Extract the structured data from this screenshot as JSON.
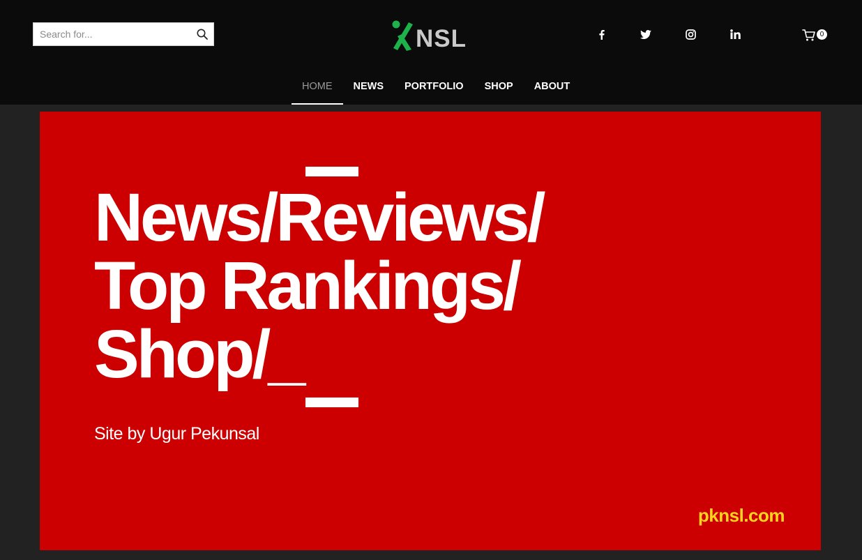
{
  "header": {
    "search": {
      "placeholder": "Search for...",
      "value": "",
      "icon": "search-icon"
    },
    "logo": {
      "text": "NSL",
      "mark_icon": "percent-logo-mark",
      "mark_color": "#1db34a",
      "text_color": "#c9c9c9"
    },
    "social": [
      {
        "name": "facebook",
        "glyph": "f"
      },
      {
        "name": "twitter",
        "glyph": "twitter-bird"
      },
      {
        "name": "instagram",
        "glyph": "instagram-camera"
      },
      {
        "name": "linkedin",
        "glyph": "in"
      }
    ],
    "cart": {
      "icon": "cart-icon",
      "count": "0"
    }
  },
  "nav": {
    "items": [
      {
        "label": "HOME",
        "active": true
      },
      {
        "label": "NEWS",
        "active": false
      },
      {
        "label": "PORTFOLIO",
        "active": false
      },
      {
        "label": "SHOP",
        "active": false
      },
      {
        "label": "ABOUT",
        "active": false
      }
    ]
  },
  "hero": {
    "background_color": "#cc0000",
    "headline_lines": [
      "News/Reviews/",
      "Top Rankings/",
      "Shop/_"
    ],
    "tagline": "Site by Ugur Pekunsal",
    "domain": "pknsl.com",
    "domain_color": "#ffd21f"
  },
  "colors": {
    "header_bg": "#0b0b0b",
    "page_bg": "#222222",
    "nav_active": "#9a9a9a"
  }
}
